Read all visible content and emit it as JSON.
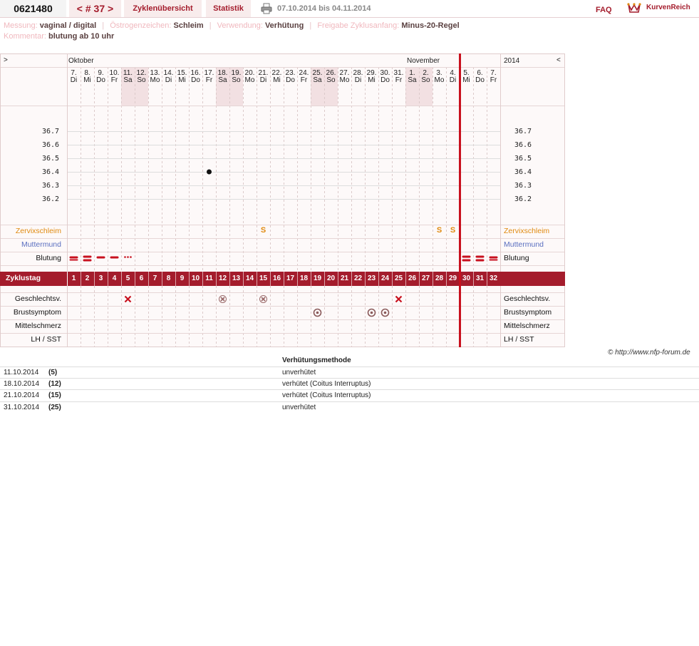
{
  "topbar": {
    "cycle_id": "0621480",
    "cycle_nav": "< # 37 >",
    "tab_overview": "Zyklenübersicht",
    "tab_stats": "Statistik",
    "date_range": "07.10.2014 bis 04.11.2014",
    "faq": "FAQ",
    "logo": "KurvenReich"
  },
  "info": {
    "messung_label": "Messung:",
    "messung": "vaginal / digital",
    "oestrogen_label": "Östrogenzeichen:",
    "oestrogen": "Schleim",
    "verwendung_label": "Verwendung:",
    "verwendung": "Verhütung",
    "freigabe_label": "Freigabe Zyklusanfang:",
    "freigabe": "Minus-20-Regel",
    "kommentar_label": "Kommentar:",
    "kommentar": "blutung ab 10 uhr"
  },
  "chart": {
    "nav_prev": ">",
    "nav_next": "<",
    "year": "2014",
    "month_oct": "Oktober",
    "month_nov": "November",
    "days": [
      {
        "d": "7.",
        "w": "Di"
      },
      {
        "d": "8.",
        "w": "Mi"
      },
      {
        "d": "9.",
        "w": "Do"
      },
      {
        "d": "10.",
        "w": "Fr"
      },
      {
        "d": "11.",
        "w": "Sa"
      },
      {
        "d": "12.",
        "w": "So"
      },
      {
        "d": "13.",
        "w": "Mo"
      },
      {
        "d": "14.",
        "w": "Di"
      },
      {
        "d": "15.",
        "w": "Mi"
      },
      {
        "d": "16.",
        "w": "Do"
      },
      {
        "d": "17.",
        "w": "Fr"
      },
      {
        "d": "18.",
        "w": "Sa"
      },
      {
        "d": "19.",
        "w": "So"
      },
      {
        "d": "20.",
        "w": "Mo"
      },
      {
        "d": "21.",
        "w": "Di"
      },
      {
        "d": "22.",
        "w": "Mi"
      },
      {
        "d": "23.",
        "w": "Do"
      },
      {
        "d": "24.",
        "w": "Fr"
      },
      {
        "d": "25.",
        "w": "Sa"
      },
      {
        "d": "26.",
        "w": "So"
      },
      {
        "d": "27.",
        "w": "Mo"
      },
      {
        "d": "28.",
        "w": "Di"
      },
      {
        "d": "29.",
        "w": "Mi"
      },
      {
        "d": "30.",
        "w": "Do"
      },
      {
        "d": "31.",
        "w": "Fr"
      },
      {
        "d": "1.",
        "w": "Sa"
      },
      {
        "d": "2.",
        "w": "So"
      },
      {
        "d": "3.",
        "w": "Mo"
      },
      {
        "d": "4.",
        "w": "Di"
      },
      {
        "d": "5.",
        "w": "Mi"
      },
      {
        "d": "6.",
        "w": "Do"
      },
      {
        "d": "7.",
        "w": "Fr"
      }
    ],
    "temp_ticks": [
      "36.7",
      "36.6",
      "36.5",
      "36.4",
      "36.3",
      "36.2"
    ],
    "temperature_point": {
      "cycle_day": 11,
      "value": 36.4
    },
    "labels": {
      "cervix": "Zervixschleim",
      "muttermund": "Muttermund",
      "blutung": "Blutung",
      "zyklustag": "Zyklustag",
      "gv": "Geschlechtsv.",
      "brust": "Brustsymptom",
      "mittel": "Mittelschmerz",
      "lh": "LH / SST"
    },
    "cervix_mark": "S",
    "cervix_days": [
      15,
      28,
      29
    ],
    "bleeding": [
      {
        "day": 1,
        "level": "medium"
      },
      {
        "day": 2,
        "level": "heavy"
      },
      {
        "day": 3,
        "level": "light"
      },
      {
        "day": 4,
        "level": "light"
      },
      {
        "day": 5,
        "level": "spotting"
      },
      {
        "day": 30,
        "level": "heavy"
      },
      {
        "day": 31,
        "level": "heavy"
      },
      {
        "day": 32,
        "level": "medium"
      }
    ],
    "intercourse": [
      {
        "day": 5,
        "protected": false
      },
      {
        "day": 12,
        "protected": true
      },
      {
        "day": 15,
        "protected": true
      },
      {
        "day": 25,
        "protected": false
      }
    ],
    "breast_days": [
      19,
      23,
      24
    ],
    "cycle_days": [
      "1",
      "2",
      "3",
      "4",
      "5",
      "6",
      "7",
      "8",
      "9",
      "10",
      "11",
      "12",
      "13",
      "14",
      "15",
      "16",
      "17",
      "18",
      "19",
      "20",
      "21",
      "22",
      "23",
      "24",
      "25",
      "26",
      "27",
      "28",
      "29",
      "30",
      "31",
      "32"
    ],
    "weekend_indices": [
      4,
      5,
      11,
      12,
      18,
      19,
      25,
      26
    ],
    "colors": {
      "accent": "#a41c2c",
      "cervix": "#e08a10",
      "muttermund": "#5a6fc0",
      "cycle_line": "#c8101e",
      "weekend": "#f2e0e2"
    }
  },
  "copyright": "© http://www.nfp-forum.de",
  "method": {
    "header": "Verhütungsmethode",
    "rows": [
      {
        "date": "11.10.2014",
        "day": "(5)",
        "method": "unverhütet"
      },
      {
        "date": "18.10.2014",
        "day": "(12)",
        "method": "verhütet (Coitus Interruptus)"
      },
      {
        "date": "21.10.2014",
        "day": "(15)",
        "method": "verhütet (Coitus Interruptus)"
      },
      {
        "date": "31.10.2014",
        "day": "(25)",
        "method": "unverhütet"
      }
    ]
  }
}
